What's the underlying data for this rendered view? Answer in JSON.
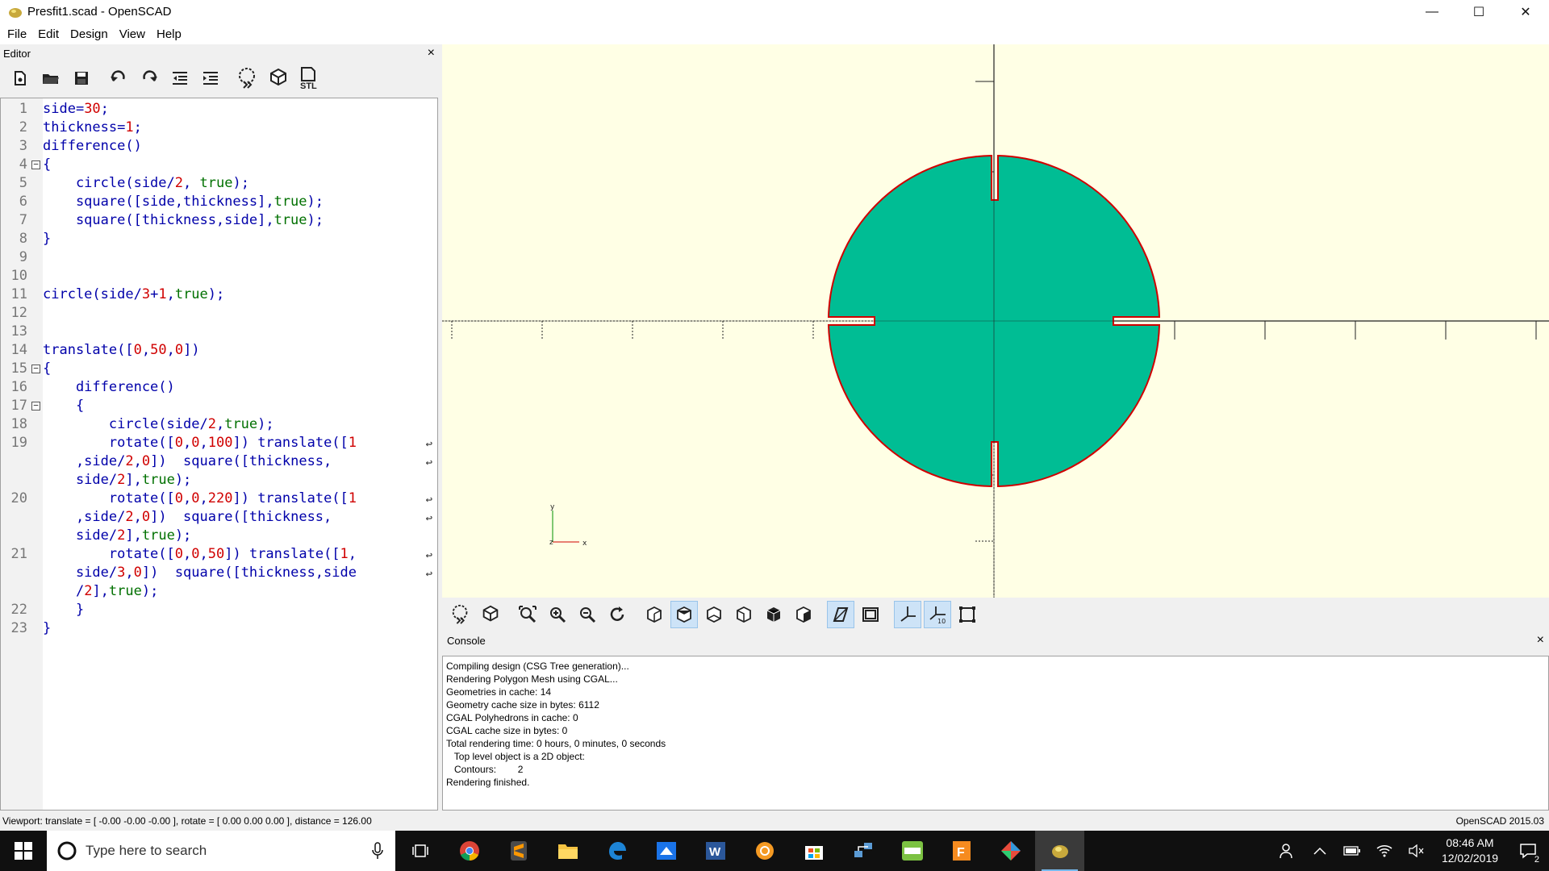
{
  "window": {
    "title": "Presfit1.scad - OpenSCAD",
    "minimize": "—",
    "maximize": "☐",
    "close": "✕"
  },
  "menu": [
    "File",
    "Edit",
    "Design",
    "View",
    "Help"
  ],
  "editor": {
    "title": "Editor",
    "close": "×",
    "toolbar_icons": [
      "new-file-icon",
      "open-file-icon",
      "save-icon",
      "undo-icon",
      "redo-icon",
      "unindent-icon",
      "indent-icon",
      "preview-icon",
      "render-icon",
      "export-stl-icon"
    ],
    "stl_label": "STL",
    "lines": [
      {
        "n": "1",
        "text": "side=30;"
      },
      {
        "n": "2",
        "text": "thickness=1;"
      },
      {
        "n": "3",
        "text": "difference()"
      },
      {
        "n": "4",
        "text": "{",
        "fold": true
      },
      {
        "n": "5",
        "text": "    circle(side/2, true);"
      },
      {
        "n": "6",
        "text": "    square([side,thickness],true);"
      },
      {
        "n": "7",
        "text": "    square([thickness,side],true);"
      },
      {
        "n": "8",
        "text": "}"
      },
      {
        "n": "9",
        "text": ""
      },
      {
        "n": "10",
        "text": ""
      },
      {
        "n": "11",
        "text": "circle(side/3+1,true);"
      },
      {
        "n": "12",
        "text": ""
      },
      {
        "n": "13",
        "text": ""
      },
      {
        "n": "14",
        "text": "translate([0,50,0])"
      },
      {
        "n": "15",
        "text": "{",
        "fold": true
      },
      {
        "n": "16",
        "text": "    difference()"
      },
      {
        "n": "17",
        "text": "    {",
        "fold": true
      },
      {
        "n": "18",
        "text": "        circle(side/2,true);"
      },
      {
        "n": "19",
        "text": "        rotate([0,0,100]) translate([1",
        "wrap": true
      },
      {
        "n": "",
        "text": "    ,side/2,0])  square([thickness,",
        "wrap": true
      },
      {
        "n": "",
        "text": "    side/2],true);"
      },
      {
        "n": "20",
        "text": "        rotate([0,0,220]) translate([1",
        "wrap": true
      },
      {
        "n": "",
        "text": "    ,side/2,0])  square([thickness,",
        "wrap": true
      },
      {
        "n": "",
        "text": "    side/2],true);"
      },
      {
        "n": "21",
        "text": "        rotate([0,0,50]) translate([1,",
        "wrap": true
      },
      {
        "n": "",
        "text": "    side/3,0])  square([thickness,side",
        "wrap": true
      },
      {
        "n": "",
        "text": "    /2],true);"
      },
      {
        "n": "22",
        "text": "    }"
      },
      {
        "n": "23",
        "text": "}"
      }
    ]
  },
  "viewer": {
    "background": "#ffffe5",
    "shape_fill": "#00bd94",
    "shape_outline": "#d00000",
    "axis_labels": {
      "x": "x",
      "y": "y",
      "z": "z"
    }
  },
  "viewer_toolbar_icons": [
    "preview-icon",
    "render-icon",
    "view-all-icon",
    "zoom-in-icon",
    "zoom-out-icon",
    "reset-view-icon",
    "view-right-icon",
    "view-top-icon",
    "view-bottom-icon",
    "view-left-icon",
    "view-front-icon",
    "view-back-icon",
    "perspective-icon",
    "orthogonal-icon",
    "show-axes-icon",
    "show-scale-markers-icon",
    "show-edges-icon"
  ],
  "console": {
    "title": "Console",
    "close": "×",
    "lines": [
      "Compiling design (CSG Tree generation)...",
      "Rendering Polygon Mesh using CGAL...",
      "Geometries in cache: 14",
      "Geometry cache size in bytes: 6112",
      "CGAL Polyhedrons in cache: 0",
      "CGAL cache size in bytes: 0",
      "Total rendering time: 0 hours, 0 minutes, 0 seconds",
      "   Top level object is a 2D object:",
      "   Contours:        2",
      "Rendering finished."
    ]
  },
  "status": {
    "viewport": "Viewport: translate = [ -0.00 -0.00 -0.00 ], rotate = [ 0.00 0.00 0.00 ], distance = 126.00",
    "version": "OpenSCAD 2015.03"
  },
  "taskbar": {
    "search_placeholder": "Type here to search",
    "apps": [
      "task-view-icon",
      "chrome-icon",
      "sublime-icon",
      "file-explorer-icon",
      "edge-icon",
      "app-icon",
      "word-icon",
      "orange-app-icon",
      "store-icon",
      "network-app-icon",
      "green-app-icon",
      "fusion-icon",
      "kite-icon",
      "openscad-icon"
    ],
    "time": "08:46 AM",
    "date": "12/02/2019",
    "notifications": "2"
  }
}
